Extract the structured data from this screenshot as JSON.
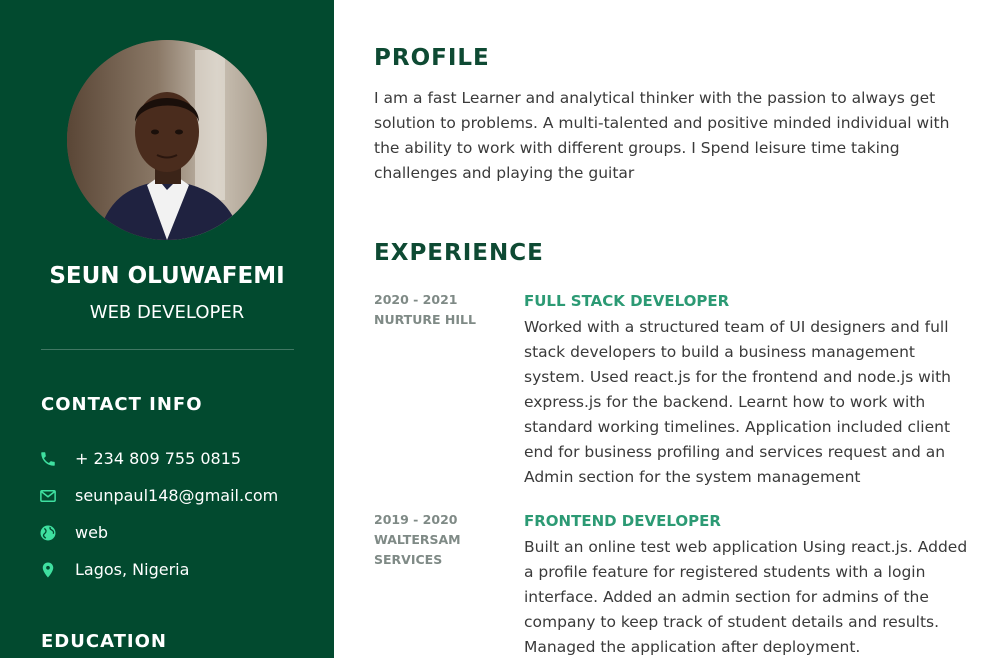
{
  "person": {
    "name": "SEUN OLUWAFEMI",
    "role": "WEB DEVELOPER"
  },
  "contact": {
    "heading": "CONTACT INFO",
    "items": [
      {
        "icon": "phone-icon",
        "text": "+ 234 809 755 0815"
      },
      {
        "icon": "mail-icon",
        "text": "seunpaul148@gmail.com"
      },
      {
        "icon": "globe-icon",
        "text": "web"
      },
      {
        "icon": "location-pin-icon",
        "text": "Lagos, Nigeria"
      }
    ]
  },
  "education": {
    "heading": "EDUCATION"
  },
  "profile": {
    "heading": "PROFILE",
    "text": "I am a fast Learner and analytical thinker with the passion to always get solution to problems. A multi-talented and positive minded individual with the ability to work with different groups. I Spend leisure time taking challenges and playing the guitar"
  },
  "experience": {
    "heading": "EXPERIENCE",
    "items": [
      {
        "period": "2020 - 2021",
        "company": "NURTURE HILL",
        "title": "FULL STACK DEVELOPER",
        "description": "Worked with a structured team of UI designers and full stack developers to build a business management system. Used react.js for the frontend and node.js with express.js for the backend. Learnt how to work with standard working timelines. Application included client end for business profiling and services request and an Admin section for the system management"
      },
      {
        "period": "2019 - 2020",
        "company": "WALTERSAM SERVICES",
        "title": "FRONTEND DEVELOPER",
        "description": "Built an online test web application Using react.js. Added a profile feature for registered students with a login interface. Added an admin section for admins of the company to keep track of student details and results. Managed the application after deployment."
      }
    ]
  },
  "colors": {
    "sidebar": "#024a2f",
    "accent": "#2c9a74",
    "heading": "#0e4a33",
    "icon": "#3fe0a0"
  }
}
